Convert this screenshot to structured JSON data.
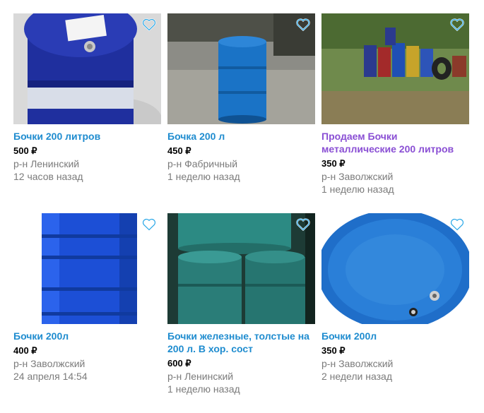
{
  "listings": [
    {
      "title": "Бочки 200 литров",
      "price": "500 ₽",
      "location": "р-н Ленинский",
      "time": "12 часов назад",
      "image_icon": "blue-barrel-photo",
      "visited": false
    },
    {
      "title": "Бочка 200 л",
      "price": "450 ₽",
      "location": "р-н Фабричный",
      "time": "1 неделю назад",
      "image_icon": "blue-barrel-photo",
      "visited": false
    },
    {
      "title": "Продаем Бочки металлические 200 литров",
      "price": "350 ₽",
      "location": "р-н Заволжский",
      "time": "1 неделю назад",
      "image_icon": "barrels-on-grass-photo",
      "visited": true
    },
    {
      "title": "Бочки 200л",
      "price": "400 ₽",
      "location": "р-н Заволжский",
      "time": "24 апреля 14:54",
      "image_icon": "blue-barrel-photo",
      "visited": false
    },
    {
      "title": "Бочки железные, толстые на 200 л. В хор. сост",
      "price": "600 ₽",
      "location": "р-н Ленинский",
      "time": "1 неделю назад",
      "image_icon": "teal-barrels-photo",
      "visited": false
    },
    {
      "title": "Бочки 200л",
      "price": "350 ₽",
      "location": "р-н Заволжский",
      "time": "2 недели назад",
      "image_icon": "barrel-top-photo",
      "visited": false
    }
  ],
  "colors": {
    "link": "#1f8ccf",
    "link_visited": "#8a4fd4",
    "muted": "#7b7b7b",
    "favorite_icon": "#2aa8e8"
  }
}
